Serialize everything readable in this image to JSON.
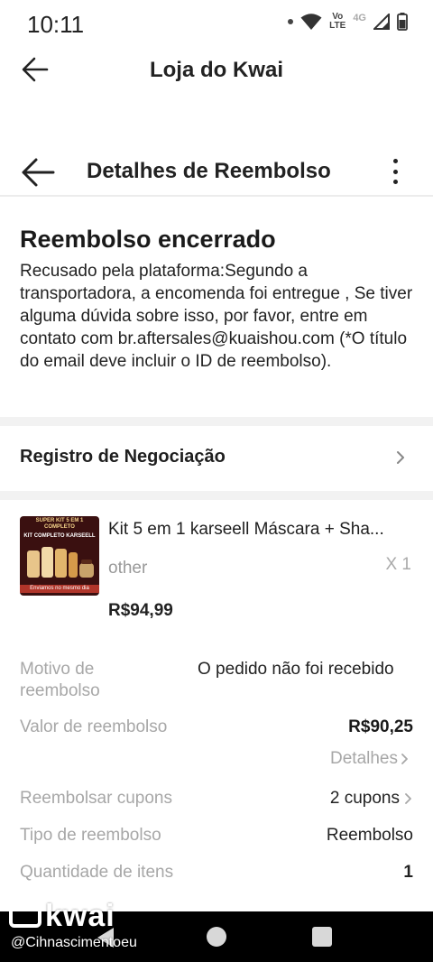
{
  "status_bar": {
    "time": "10:11",
    "volte_top": "Vo",
    "volte_bottom": "LTE",
    "network": "4G",
    "icons": [
      "dot-icon",
      "wifi-icon",
      "volte-icon",
      "signal-icon",
      "battery-icon"
    ]
  },
  "top_bar": {
    "title": "Loja do Kwai"
  },
  "detail_header": {
    "title": "Detalhes de Reembolso"
  },
  "refund_status": {
    "title": "Reembolso encerrado",
    "description": "Recusado pela plataforma:Segundo a transportadora, a encomenda foi entregue , Se tiver alguma dúvida sobre isso, por favor, entre em contato com br.aftersales@kuaishou.com (*O título do email deve incluir o ID de reembolso)."
  },
  "negotiation": {
    "label": "Registro de Negociação"
  },
  "product": {
    "name": "Kit 5 em 1 karseell Máscara + Sha...",
    "variant": "other",
    "quantity": "X 1",
    "price": "R$94,99",
    "thumb_top": "SUPER KIT 5 EM 1 COMPLETO",
    "thumb_sub": "KIT COMPLETO KARSEELL",
    "thumb_bottom": "Enviamos no mesmo dia"
  },
  "refund_info": {
    "reason_label": "Motivo de reembolso",
    "reason_value": "O pedido não foi recebido",
    "amount_label": "Valor de reembolso",
    "amount_value": "R$90,25",
    "details_link": "Detalhes",
    "coupons_label": "Reembolsar cupons",
    "coupons_value": "2 cupons",
    "type_label": "Tipo de reembolso",
    "type_value": "Reembolso",
    "quantity_label": "Quantidade de itens",
    "quantity_value": "1"
  },
  "watermark": {
    "logo": "kwai",
    "username": "@Cihnascimentoeu"
  },
  "colors": {
    "muted_label": "#a7a7a7",
    "separator": "#f2f2f2",
    "nav_bar": "#000000"
  }
}
